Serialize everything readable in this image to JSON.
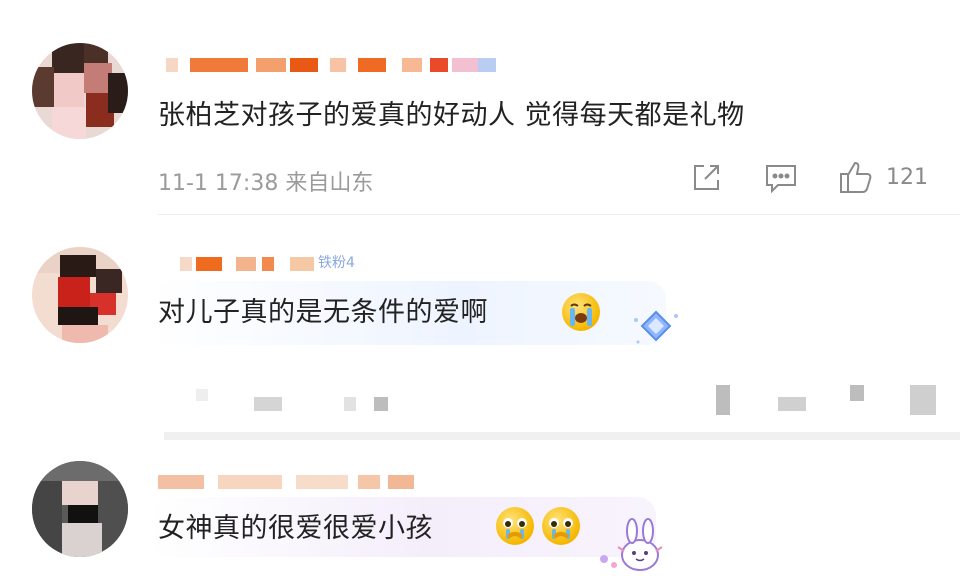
{
  "comments": [
    {
      "text": "张柏芝对孩子的爱真的好动人 觉得每天都是礼物",
      "meta": "11-1 17:38 来自山东",
      "like_count": "121",
      "actions": [
        "share-icon",
        "comment-icon",
        "like-icon"
      ]
    },
    {
      "text": "对儿子真的是无条件的爱啊",
      "fan_badge": "铁粉4",
      "emoji": "crying-face-emoji",
      "decoration": "diamond-badge"
    },
    {
      "text": "女神真的很爱很爱小孩",
      "emoji": [
        "pleading-face-emoji",
        "pleading-face-emoji"
      ],
      "decoration": "bunny-sticker"
    }
  ],
  "colors": {
    "text": "#222222",
    "meta": "#9b9b9b",
    "accent_orange": "#f06a1c",
    "badge_blue": "#8aa8e0",
    "bubble_blue": "#eef4ff",
    "bubble_purple": "#f4eefb"
  }
}
